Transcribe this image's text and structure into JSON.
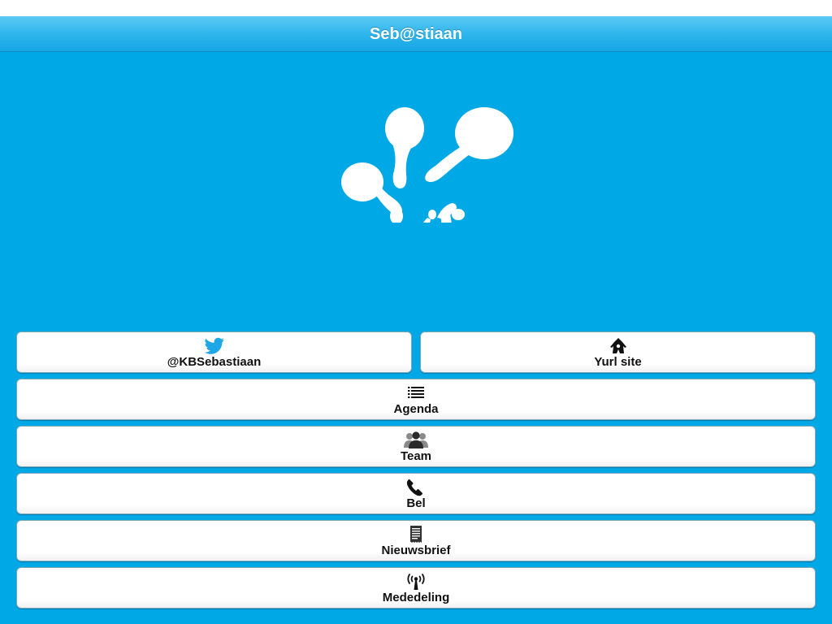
{
  "navbar": {
    "title": "Seb@stiaan"
  },
  "logo": {
    "icon": "splash-logo-icon",
    "color": "#ffffff"
  },
  "buttons": [
    {
      "label": "@KBSebastiaan",
      "icon": "twitter-bird-icon",
      "icon_color": "#1ea7e6"
    },
    {
      "label": "Yurl site",
      "icon": "yurl-site-icon",
      "icon_color": "#111111"
    },
    {
      "label": "Agenda",
      "icon": "list-icon",
      "icon_color": "#111111"
    },
    {
      "label": "Team",
      "icon": "people-icon",
      "icon_color": "#333333"
    },
    {
      "label": "Bel",
      "icon": "phone-icon",
      "icon_color": "#111111"
    },
    {
      "label": "Nieuwsbrief",
      "icon": "newsletter-icon",
      "icon_color": "#222222"
    },
    {
      "label": "Mededeling",
      "icon": "broadcast-antenna-icon",
      "icon_color": "#111111"
    }
  ],
  "colors": {
    "background": "#00a8e6",
    "navbar_accent": "#2fb6ec",
    "button_border": "#7fa7bb"
  }
}
